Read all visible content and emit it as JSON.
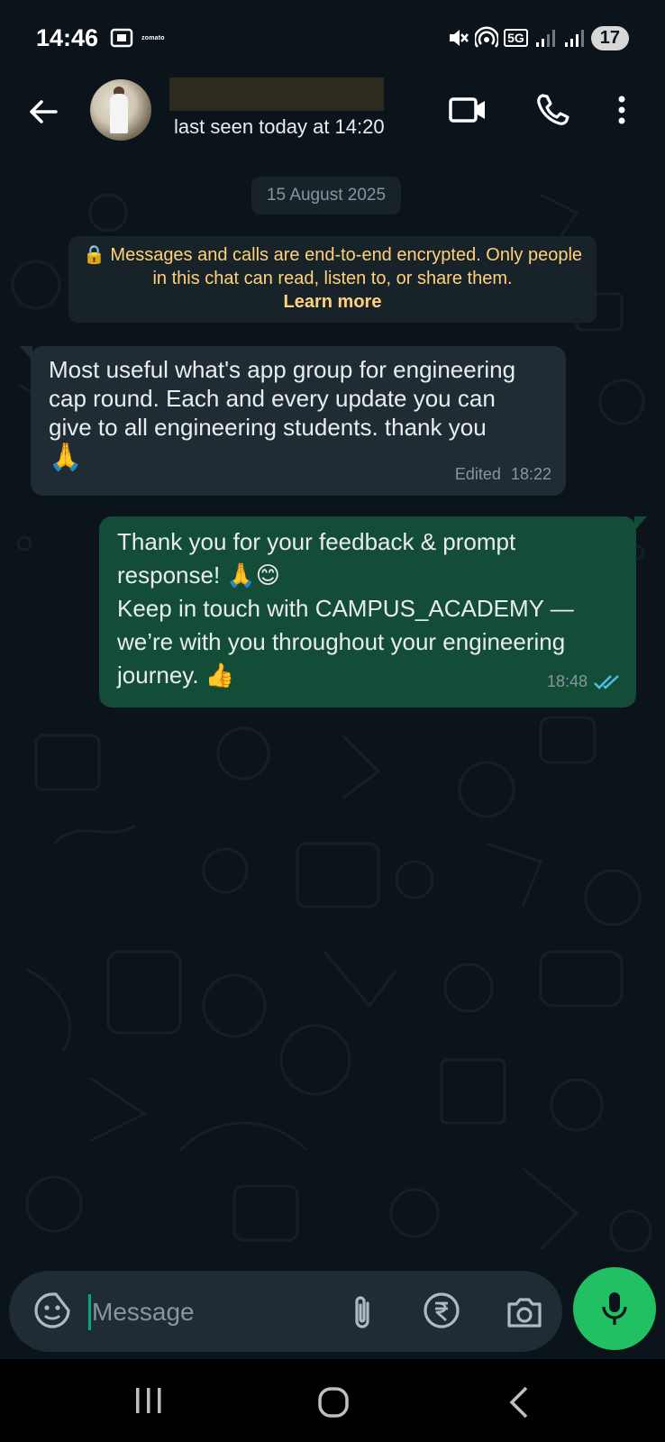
{
  "status_bar": {
    "time": "14:46",
    "app_label": "zomato",
    "network": "5G",
    "battery": "17"
  },
  "header": {
    "last_seen": "last seen today at 14:20"
  },
  "chat": {
    "date_chip": "15 August 2025",
    "encryption_notice": "Messages and calls are end-to-end encrypted. Only people in this chat can read, listen to, or share them.",
    "learn_more": "Learn more",
    "messages": [
      {
        "direction": "incoming",
        "text_line1": "Most useful what's app group for engineering",
        "text_line2": "cap round. Each and every update you can",
        "text_line3": "give to all engineering students.  thank you",
        "emoji": "🙏",
        "edited_label": "Edited",
        "time": "18:22"
      },
      {
        "direction": "outgoing",
        "text_line1": "Thank you for your feedback & prompt",
        "text_line2": "response! 🙏😊",
        "text_line3": "Keep in touch with CAMPUS_ACADEMY —",
        "text_line4": "we’re with you throughout your engineering",
        "text_line5": "journey. 👍",
        "time": "18:48",
        "status": "read"
      }
    ]
  },
  "composer": {
    "placeholder": "Message"
  },
  "colors": {
    "background": "#0b141a",
    "incoming_bubble": "#202c33",
    "outgoing_bubble": "#144d37",
    "accent_green": "#21c063",
    "notice_text": "#ffd279",
    "read_ticks": "#53bdeb"
  },
  "icons": {
    "back": "arrow-left-icon",
    "video": "video-call-icon",
    "call": "phone-icon",
    "more": "more-vertical-icon",
    "emoji": "sticker-icon",
    "attach": "paperclip-icon",
    "payment": "rupee-icon",
    "camera": "camera-icon",
    "mic": "microphone-icon"
  }
}
